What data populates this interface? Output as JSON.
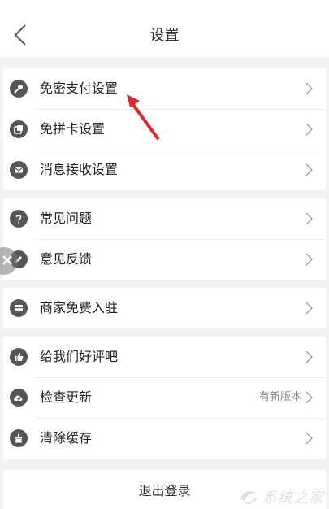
{
  "header": {
    "title": "设置"
  },
  "groups": [
    {
      "items": [
        {
          "label": "免密支付设置",
          "icon": "key-icon"
        },
        {
          "label": "免拼卡设置",
          "icon": "card-icon"
        },
        {
          "label": "消息接收设置",
          "icon": "envelope-icon"
        }
      ]
    },
    {
      "items": [
        {
          "label": "常见问题",
          "icon": "question-icon"
        },
        {
          "label": "意见反馈",
          "icon": "pencil-icon"
        }
      ]
    },
    {
      "items": [
        {
          "label": "商家免费入驻",
          "icon": "store-icon"
        }
      ]
    },
    {
      "items": [
        {
          "label": "给我们好评吧",
          "icon": "thumbs-up-icon"
        },
        {
          "label": "检查更新",
          "icon": "cloud-upload-icon",
          "value": "有新版本"
        },
        {
          "label": "清除缓存",
          "icon": "broom-icon"
        }
      ]
    }
  ],
  "logout": {
    "label": "退出登录"
  },
  "watermark": {
    "text": "系统之家"
  },
  "colors": {
    "background": "#f2f2f2",
    "icon": "#555555",
    "annotation_arrow": "#e0262b",
    "secondary_text": "#888888"
  }
}
